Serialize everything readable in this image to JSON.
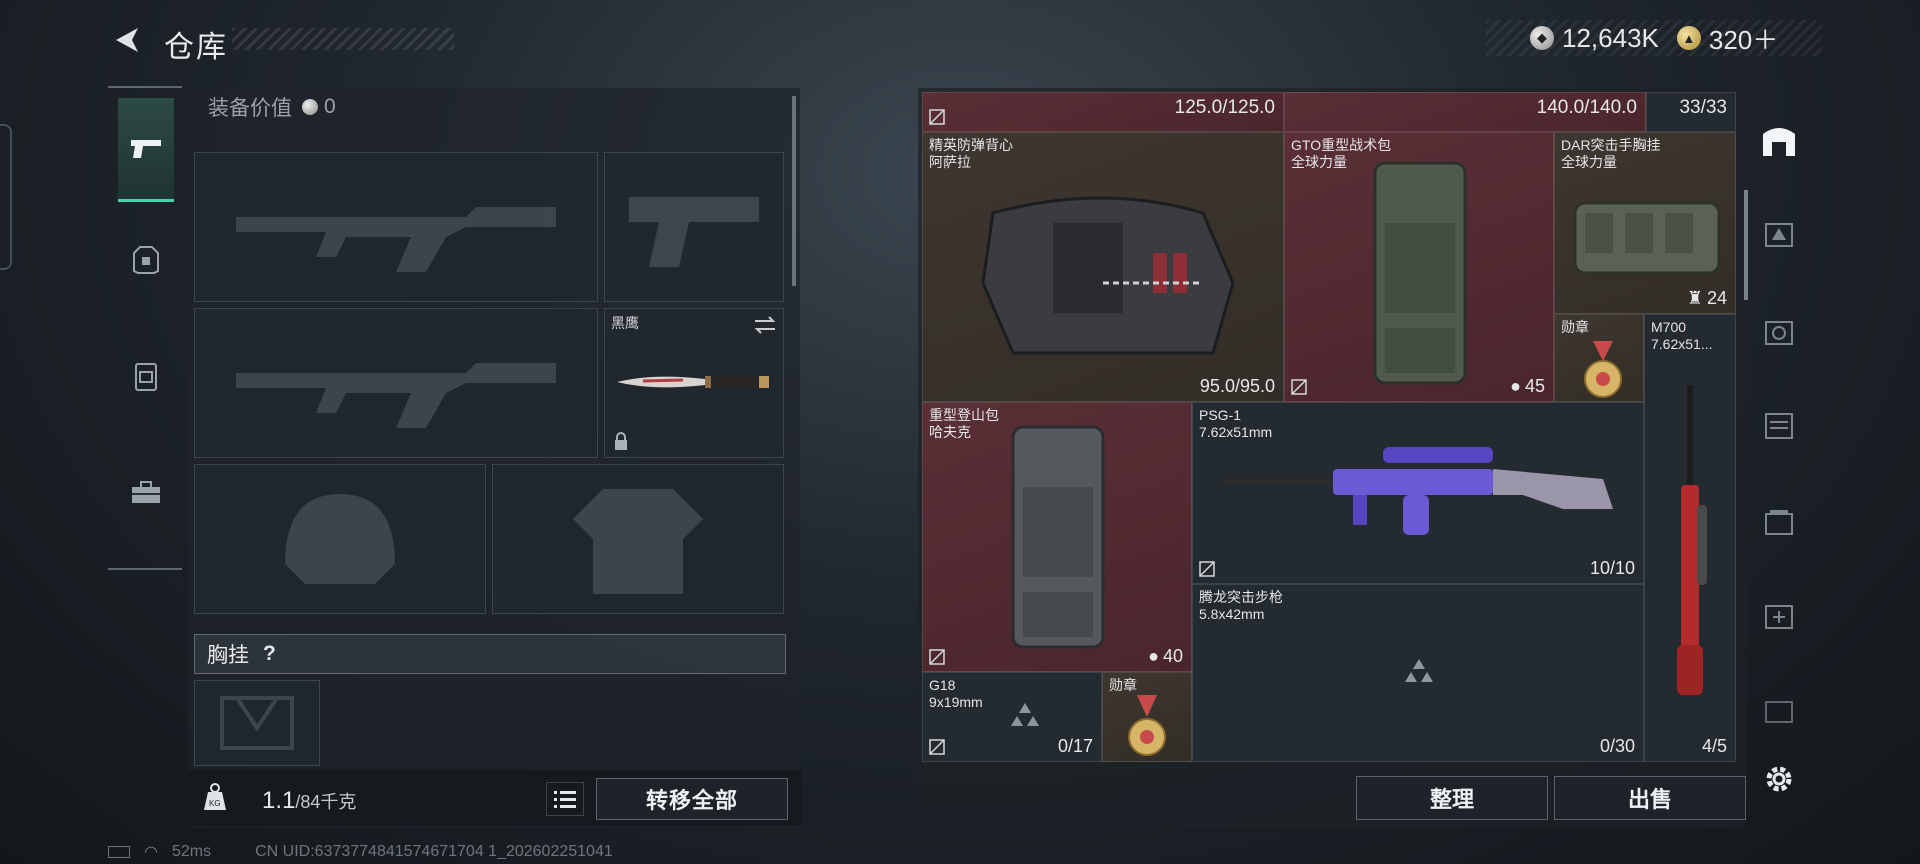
{
  "header": {
    "title": "仓库",
    "currencies": [
      {
        "icon": "silver-coin-icon",
        "value": "12,643K"
      },
      {
        "icon": "gold-coin-icon",
        "value": "320＋"
      }
    ]
  },
  "left_nav": [
    {
      "name": "weapons",
      "icon": "pistol-icon",
      "active": true
    },
    {
      "name": "armor",
      "icon": "vest-icon",
      "active": false
    },
    {
      "name": "backpack",
      "icon": "backpack-icon",
      "active": false
    },
    {
      "name": "toolbox",
      "icon": "toolbox-icon",
      "active": false
    }
  ],
  "loadout": {
    "equip_value_label": "装备价值",
    "equip_value": "0",
    "knife_label": "黑鹰",
    "chest_label": "胸挂",
    "chest_help": "?",
    "weight_value": "1.1",
    "weight_max": "/84千克",
    "transfer_all": "转移全部"
  },
  "storage": {
    "top_left_dur": "125.0/125.0",
    "top_right_dur": "140.0/140.0",
    "top_count": "33/33",
    "items": {
      "vest": {
        "name": "精英防弹背心",
        "sub": "阿萨拉",
        "dur": "95.0/95.0"
      },
      "bag_gto": {
        "name": "GTO重型战术包",
        "sub": "全球力量",
        "cap": "45"
      },
      "chest_dar": {
        "name": "DAR突击手胸挂",
        "sub": "全球力量",
        "cap": "24"
      },
      "medal1": {
        "name": "勋章"
      },
      "m700": {
        "name": "M700",
        "sub": "7.62x51..."
      },
      "bag_heavy": {
        "name": "重型登山包",
        "sub": "哈夫克",
        "cap": "40"
      },
      "psg": {
        "name": "PSG-1",
        "sub": "7.62x51mm",
        "count": "10/10"
      },
      "tenglong": {
        "name": "腾龙突击步枪",
        "sub": "5.8x42mm",
        "count": "0/30"
      },
      "g18": {
        "name": "G18",
        "sub": "9x19mm",
        "count": "0/17"
      },
      "medal2": {
        "name": "勋章"
      },
      "m700_count": "4/5"
    },
    "sort_btn": "整理",
    "sell_btn": "出售"
  },
  "status": {
    "ping": "52ms",
    "uid": "CN UID:6373774841574671704 1_202602251041"
  },
  "colors": {
    "accent": "#3ed7b0",
    "item_red": "#5a2f36",
    "item_brown": "#3e3730"
  }
}
